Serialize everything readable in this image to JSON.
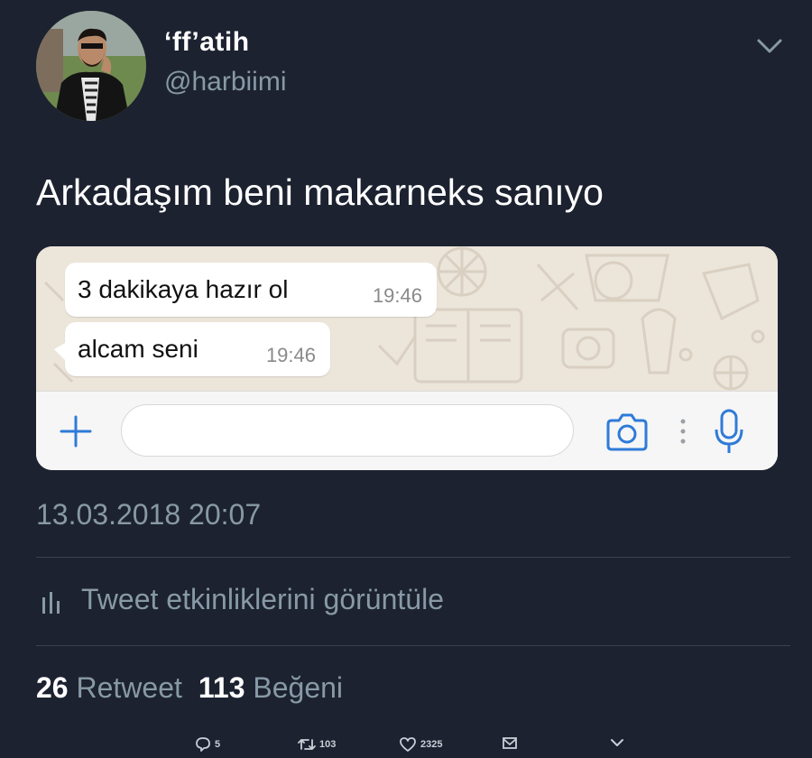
{
  "header": {
    "display_name": "‘ff’atih",
    "handle": "@harbiimi"
  },
  "tweet": {
    "text": "Arkadaşım beni makarneks sanıyo",
    "timestamp": "13.03.2018 20:07"
  },
  "media": {
    "messages": [
      {
        "text": "3 dakikaya hazır ol",
        "time": "19:46"
      },
      {
        "text": "alcam seni",
        "time": "19:46"
      }
    ],
    "input_placeholder": "",
    "colors": {
      "chat_background": "#ece5da",
      "accent": "#2f7bd8"
    }
  },
  "activity": {
    "label": "Tweet etkinliklerini görüntüle",
    "icon": "bar-chart-icon"
  },
  "stats": {
    "retweets_count": "26",
    "retweets_label": "Retweet",
    "likes_count": "113",
    "likes_label": "Beğeni"
  },
  "action_bar": {
    "reply_count": "5",
    "retweet_count": "103",
    "like_count": "2325",
    "icons": [
      "reply-icon",
      "retweet-icon",
      "heart-icon",
      "mail-icon",
      "chevron-down-icon"
    ]
  },
  "theme": {
    "background": "#1c2230",
    "secondary_text": "#8899a6",
    "divider": "#38444d"
  }
}
